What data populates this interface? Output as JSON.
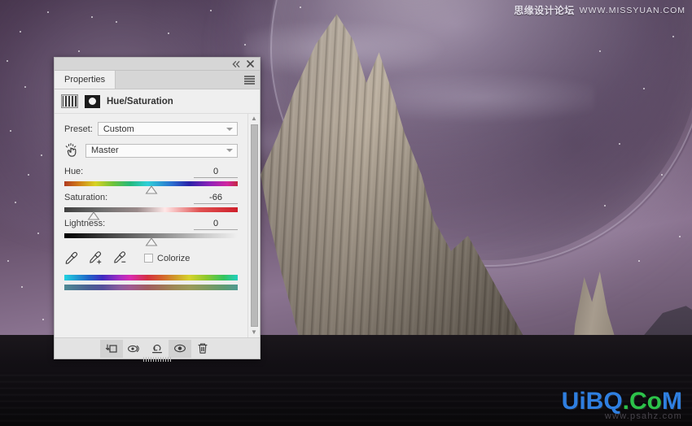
{
  "artwork": {
    "description": "Dark purple alien sky with large planet, rocky desert massif and dark foreground terrain",
    "sky_color": "#6b5570",
    "rock_color": "#a79c8f",
    "ground_color": "#131015"
  },
  "watermark_top": {
    "cn_text": "思缘设计论坛",
    "url_text": "WWW.MISSYUAN.COM"
  },
  "watermark_logo": {
    "part1": "UiBQ",
    "part2": ".Co",
    "part3": "M",
    "sub": "www.psahz.com",
    "blue": "#2f7fe0",
    "green": "#2cc24a"
  },
  "panel": {
    "titlebar": {
      "collapse_label": "«",
      "close_label": "✕"
    },
    "tabs": [
      {
        "label": "Properties",
        "active": true
      }
    ],
    "menu_label": "panel-menu",
    "adjustment": {
      "title": "Hue/Saturation",
      "preset_thumb": "gradient-preset-thumbnail",
      "mask_thumb": "layer-mask-thumbnail"
    },
    "preset_row": {
      "label": "Preset:",
      "value": "Custom"
    },
    "channel_row": {
      "value": "Master",
      "target_tool": "targeted-adjustment-hand"
    },
    "sliders": [
      {
        "name": "Hue:",
        "value": "0",
        "thumb_pct": 50,
        "kind": "hue"
      },
      {
        "name": "Saturation:",
        "value": "-66",
        "thumb_pct": 17,
        "kind": "sat"
      },
      {
        "name": "Lightness:",
        "value": "0",
        "thumb_pct": 50,
        "kind": "light"
      }
    ],
    "tools": {
      "eyedropper": "eyedropper",
      "eyedropper_add": "eyedropper-add",
      "eyedropper_subtract": "eyedropper-subtract",
      "colorize_label": "Colorize",
      "colorize_checked": false
    },
    "spectrum": {
      "top_label": "hue-spectrum-bar",
      "bottom_label": "result-spectrum-bar"
    },
    "scrollbar": {
      "up": "▲",
      "down": "▼"
    },
    "footer_buttons": [
      {
        "name": "clip-to-layer-button",
        "active": true
      },
      {
        "name": "view-previous-state-button",
        "active": false
      },
      {
        "name": "reset-button",
        "active": false
      },
      {
        "name": "toggle-visibility-button",
        "active": true
      },
      {
        "name": "delete-adjustment-button",
        "active": false
      }
    ]
  }
}
